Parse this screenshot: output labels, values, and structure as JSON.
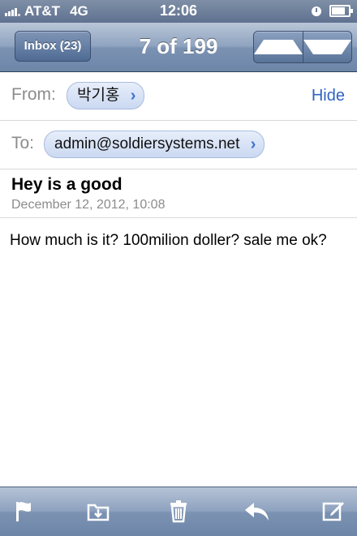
{
  "status_bar": {
    "carrier": "AT&T",
    "network": "4G",
    "time": "12:06"
  },
  "nav": {
    "back_label": "Inbox (23)",
    "title": "7 of 199"
  },
  "header": {
    "from_label": "From:",
    "from_value": "박기홍",
    "hide_label": "Hide",
    "to_label": "To:",
    "to_value": "admin@soldiersystems.net"
  },
  "message": {
    "subject": "Hey is a good",
    "date": "December 12, 2012, 10:08",
    "body": "How much is it? 100milion doller? sale me ok?"
  },
  "toolbar": {
    "icons": [
      "flag-icon",
      "move-folder-icon",
      "trash-icon",
      "reply-icon",
      "compose-icon"
    ]
  },
  "colors": {
    "link": "#2f64c0",
    "nav_bar": "#7b92b2",
    "chip": "#cad8f1"
  }
}
